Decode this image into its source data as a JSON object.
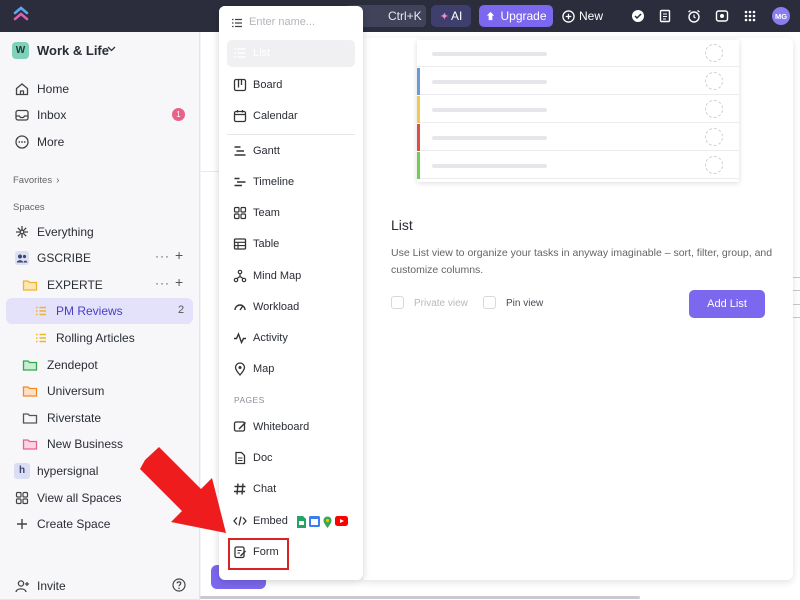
{
  "topbar": {
    "search_shortcut": "Ctrl+K",
    "ai_label": "AI",
    "upgrade_label": "Upgrade",
    "new_label": "New",
    "avatar_initials": "MG"
  },
  "sidebar": {
    "workspace_initial": "W",
    "workspace_name": "Work & Life",
    "nav": [
      {
        "label": "Home",
        "icon": "home-icon"
      },
      {
        "label": "Inbox",
        "icon": "inbox-icon",
        "badge": "1"
      },
      {
        "label": "More",
        "icon": "more-icon"
      }
    ],
    "favorites_label": "Favorites",
    "spaces_label": "Spaces",
    "items": [
      {
        "label": "Everything",
        "icon": "everything-icon"
      },
      {
        "label": "GSCRIBE",
        "icon": "team-space-icon"
      },
      {
        "label": "EXPERTE",
        "icon": "folder-icon"
      },
      {
        "label": "PM Reviews",
        "icon": "list-icon",
        "count": "2"
      },
      {
        "label": "Rolling Articles",
        "icon": "list-icon"
      },
      {
        "label": "Zendepot",
        "icon": "folder-icon"
      },
      {
        "label": "Universum",
        "icon": "folder-icon"
      },
      {
        "label": "Riverstate",
        "icon": "folder-icon"
      },
      {
        "label": "New Business",
        "icon": "folder-icon"
      },
      {
        "label": "hypersignal",
        "icon": "space-icon",
        "initial": "h"
      },
      {
        "label": "View all Spaces",
        "icon": "grid-icon"
      },
      {
        "label": "Create Space",
        "icon": "plus-icon"
      }
    ],
    "invite_label": "Invite"
  },
  "view_menu": {
    "search_placeholder": "Enter name...",
    "views": [
      {
        "label": "List",
        "icon": "list-icon"
      },
      {
        "label": "Board",
        "icon": "board-icon"
      },
      {
        "label": "Calendar",
        "icon": "calendar-icon"
      },
      {
        "label": "Gantt",
        "icon": "gantt-icon"
      },
      {
        "label": "Timeline",
        "icon": "timeline-icon"
      },
      {
        "label": "Team",
        "icon": "team-icon"
      },
      {
        "label": "Table",
        "icon": "table-icon"
      },
      {
        "label": "Mind Map",
        "icon": "mind-map-icon"
      },
      {
        "label": "Workload",
        "icon": "workload-icon"
      },
      {
        "label": "Activity",
        "icon": "activity-icon"
      },
      {
        "label": "Map",
        "icon": "map-icon"
      }
    ],
    "pages_label": "PAGES",
    "pages": [
      {
        "label": "Whiteboard",
        "icon": "whiteboard-icon"
      },
      {
        "label": "Doc",
        "icon": "doc-icon"
      },
      {
        "label": "Chat",
        "icon": "chat-icon"
      },
      {
        "label": "Embed",
        "icon": "embed-icon"
      },
      {
        "label": "Form",
        "icon": "form-icon"
      }
    ]
  },
  "info_panel": {
    "title": "List",
    "description": "Use List view to organize your tasks in anyway imaginable – sort, filter, group, and customize columns.",
    "private_view_label": "Private view",
    "pin_view_label": "Pin view",
    "add_button_label": "Add List",
    "preview_colors": [
      "#6a9bd8",
      "#f2c94c",
      "#e04b4b",
      "#6fcf52"
    ]
  },
  "colors": {
    "accent": "#7b68ee",
    "topbar": "#2b2d3c",
    "highlight_box": "#d62424",
    "arrow": "#ee1c1c"
  }
}
